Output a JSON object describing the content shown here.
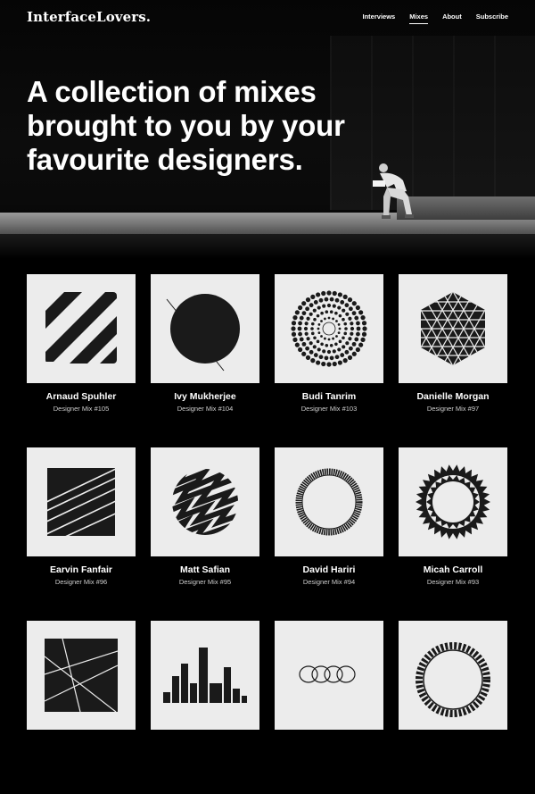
{
  "brand": {
    "logo": "InterfaceLovers."
  },
  "nav": [
    {
      "label": "Interviews",
      "active": false
    },
    {
      "label": "Mixes",
      "active": true
    },
    {
      "label": "About",
      "active": false
    },
    {
      "label": "Subscribe",
      "active": false
    }
  ],
  "hero": {
    "headline_lines": [
      "A collection of mixes",
      "brought to you by your",
      "favourite designers."
    ]
  },
  "mixes": [
    {
      "name": "Arnaud Spuhler",
      "mix": "Designer Mix #105",
      "art": "diagonal-bars-icon"
    },
    {
      "name": "Ivy Mukherjee",
      "mix": "Designer Mix #104",
      "art": "circle-slash-icon"
    },
    {
      "name": "Budi Tanrim",
      "mix": "Designer Mix #103",
      "art": "dotted-rings-icon"
    },
    {
      "name": "Danielle Morgan",
      "mix": "Designer Mix #97",
      "art": "hexagon-grid-icon"
    },
    {
      "name": "Earvin Fanfair",
      "mix": "Designer Mix #96",
      "art": "striped-square-icon"
    },
    {
      "name": "Matt Safian",
      "mix": "Designer Mix #95",
      "art": "zigzag-sphere-icon"
    },
    {
      "name": "David Hariri",
      "mix": "Designer Mix #94",
      "art": "ribbed-ring-icon"
    },
    {
      "name": "Micah Carroll",
      "mix": "Designer Mix #93",
      "art": "spiked-ring-icon"
    },
    {
      "name": "",
      "mix": "",
      "art": "crossed-lines-square-icon"
    },
    {
      "name": "",
      "mix": "",
      "art": "bar-graph-icon"
    },
    {
      "name": "",
      "mix": "",
      "art": "linked-rings-icon"
    },
    {
      "name": "",
      "mix": "",
      "art": "wavy-ring-icon"
    }
  ],
  "colors": {
    "background": "#000000",
    "cover": "#ececec",
    "art": "#1a1a1a"
  }
}
